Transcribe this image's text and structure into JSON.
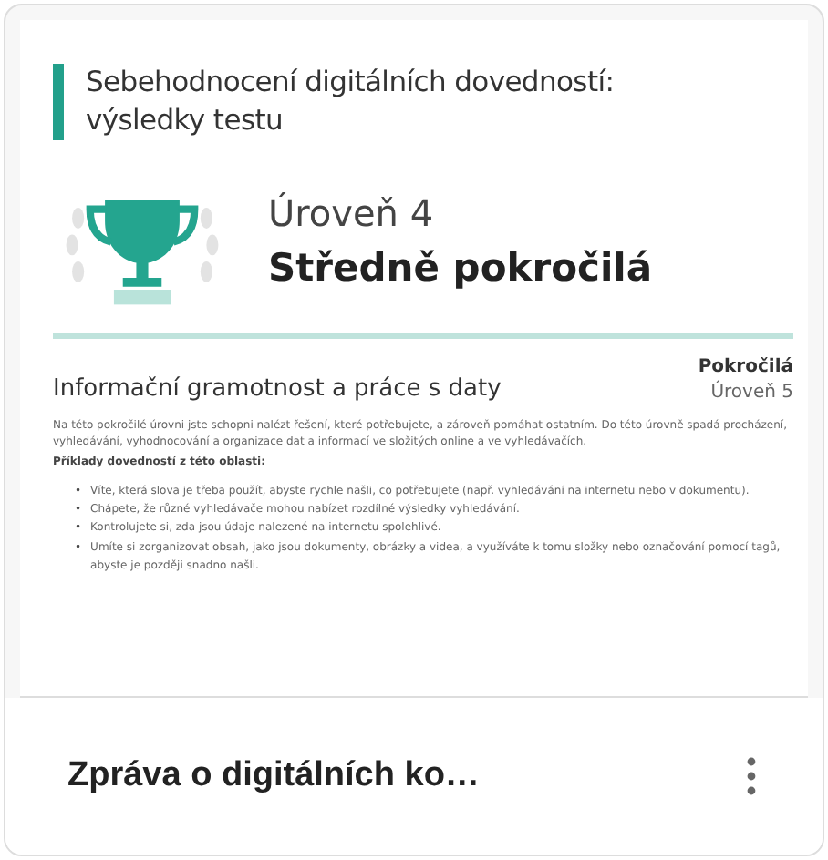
{
  "preview": {
    "heading": "Sebehodnocení digitálních dovedností: výsledky testu",
    "level_label": "Úroveň 4",
    "level_name": "Středně pokročilá",
    "section": {
      "title": "Informační gramotnost a práce s daty",
      "badge_name": "Pokročilá",
      "badge_level": "Úroveň 5",
      "intro": "Na této pokročilé úrovni jste schopni nalézt řešení, které potřebujete, a zároveň pomáhat ostatním. Do této úrovně spadá procházení, vyhledávání, vyhodnocování a organizace dat a informací ve složitých online a ve vyhledávačích.",
      "examples_label": "Příklady dovedností z této oblasti:",
      "bullets": [
        {
          "marker": "•",
          "text": "Víte, která slova je třeba použít, abyste rychle našli, co potřebujete (např. vyhledávání na internetu nebo v dokumentu)."
        },
        {
          "marker": "•",
          "text": "Chápete, že různé vyhledávače mohou nabízet rozdílné výsledky vyhledávání."
        },
        {
          "marker": "•",
          "text": "Kontrolujete si, zda jsou údaje nalezené na internetu spolehlivé."
        },
        {
          "marker": "•",
          "text": "Umíte si zorganizovat obsah, jako jsou dokumenty, obrázky a videa, a využíváte k tomu složky nebo označování pomocí tagů, abyste je později snadno našli."
        }
      ]
    }
  },
  "card": {
    "title": "Zpráva o digitálních ko…"
  }
}
